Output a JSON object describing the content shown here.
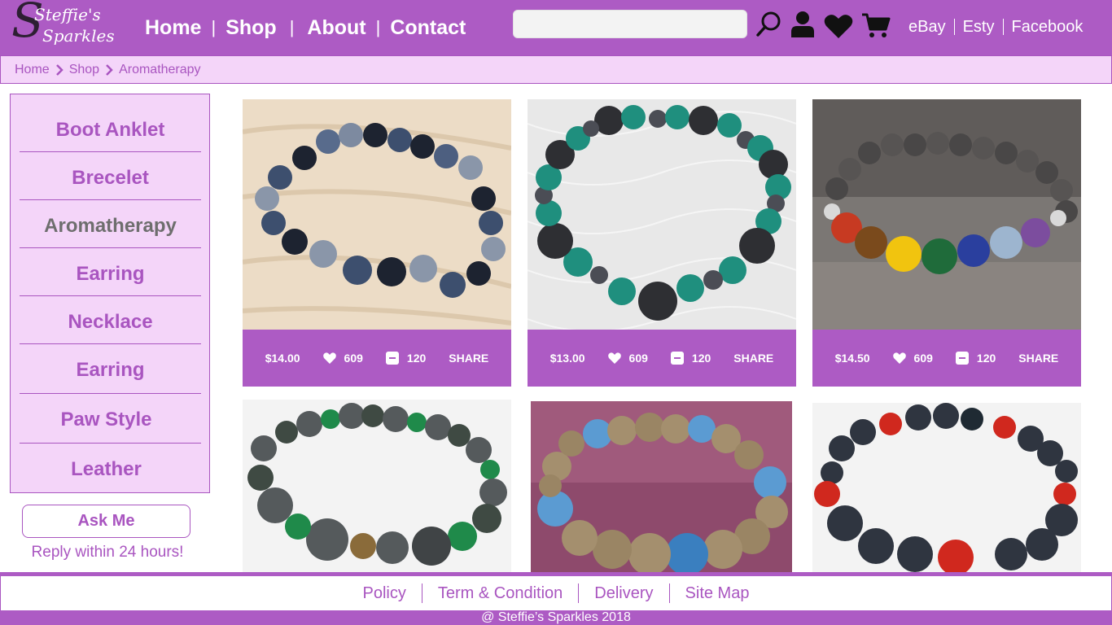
{
  "brand": {
    "line1": "Steffie's",
    "line2": "Sparkles",
    "initial": "S"
  },
  "nav": [
    {
      "label": "Home"
    },
    {
      "label": "Shop"
    },
    {
      "label": "About"
    },
    {
      "label": "Contact"
    }
  ],
  "search": {
    "placeholder": "",
    "value": ""
  },
  "header_icons": [
    "search-icon",
    "user-icon",
    "heart-icon",
    "cart-icon"
  ],
  "external_links": [
    {
      "label": "eBay"
    },
    {
      "label": "Esty"
    },
    {
      "label": "Facebook"
    }
  ],
  "breadcrumb": [
    {
      "label": "Home"
    },
    {
      "label": "Shop"
    },
    {
      "label": "Aromatherapy"
    }
  ],
  "sidebar": {
    "categories": [
      {
        "label": "Boot Anklet",
        "active": false
      },
      {
        "label": "Brecelet",
        "active": false
      },
      {
        "label": "Aromatherapy",
        "active": true
      },
      {
        "label": "Earring",
        "active": false
      },
      {
        "label": "Necklace",
        "active": false
      },
      {
        "label": "Earring",
        "active": false
      },
      {
        "label": "Paw Style",
        "active": false
      },
      {
        "label": "Leather",
        "active": false
      }
    ],
    "ask_label": "Ask Me",
    "reply_note": "Reply within 24 hours!"
  },
  "products": [
    {
      "name": "black and blue lava bead bracelet",
      "price": "$14.00",
      "likes": "609",
      "saves": "120",
      "share": "SHARE"
    },
    {
      "name": "green and black lava bead bracelet",
      "price": "$13.00",
      "likes": "609",
      "saves": "120",
      "share": "SHARE"
    },
    {
      "name": "grey lava chakra bead bracelet",
      "price": "$14.50",
      "likes": "609",
      "saves": "120",
      "share": "SHARE"
    },
    {
      "name": "black lava and green jasper bracelet"
    },
    {
      "name": "tan lava and blue bead bracelet"
    },
    {
      "name": "black lava and red bead bracelet"
    }
  ],
  "footer": {
    "links": [
      {
        "label": "Policy"
      },
      {
        "label": "Term & Condition"
      },
      {
        "label": "Delivery"
      },
      {
        "label": "Site Map"
      }
    ],
    "copyright": "@ Steffie’s Sparkles 2018"
  },
  "colors": {
    "primary": "#ad5bc4",
    "text_purple": "#a955c0",
    "light": "#f4d5f9",
    "active_gray": "#6e6e6e"
  }
}
